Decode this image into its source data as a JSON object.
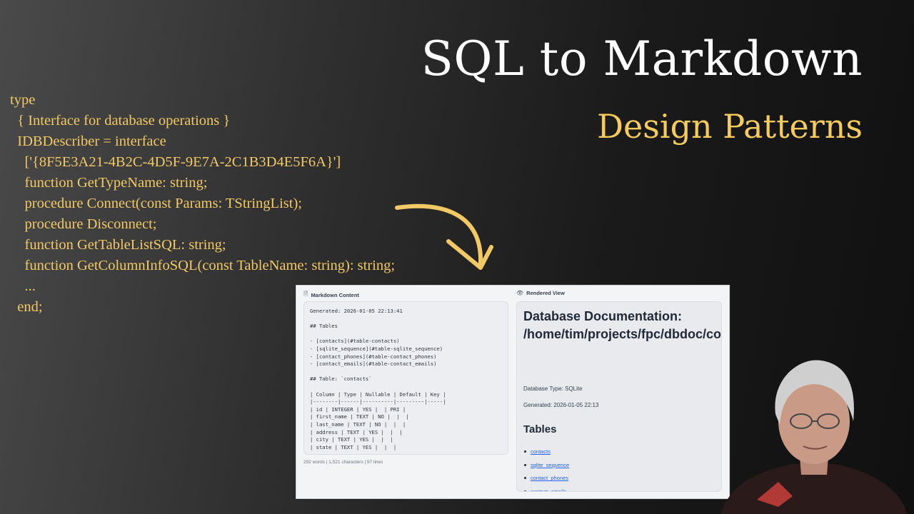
{
  "title": "SQL to Markdown",
  "subtitle": "Design Patterns",
  "colors": {
    "accent": "#f2c964",
    "link": "#2563eb"
  },
  "code_lines": [
    "type",
    "  { Interface for database operations }",
    "  IDBDescriber = interface",
    "    ['{8F5E3A21-4B2C-4D5F-9E7A-2C1B3D4E5F6A}']",
    "    function GetTypeName: string;",
    "    procedure Connect(const Params: TStringList);",
    "    procedure Disconnect;",
    "    function GetTableListSQL: string;",
    "    function GetColumnInfoSQL(const TableName: string): string;",
    "    ...",
    "  end;"
  ],
  "screenshot": {
    "markdown_panel": {
      "title": "Markdown Content",
      "icon": "file-icon",
      "lines": [
        "Generated: 2026-01-05 22:13:41",
        "",
        "## Tables",
        "",
        "- [contacts](#table-contacts)",
        "- [sqlite_sequence](#table-sqlite_sequence)",
        "- [contact_phones](#table-contact_phones)",
        "- [contact_emails](#table-contact_emails)",
        "",
        "## Table: `contacts`",
        "",
        "| Column | Type | Nullable | Default | Key |",
        "|--------|------|----------|---------|-----|",
        "| id | INTEGER | YES |  | PRI |",
        "| first_name | TEXT | NO |  |  |",
        "| last_name | TEXT | NO |  |  |",
        "| address | TEXT | YES |  |  |",
        "| city | TEXT | YES |  |  |",
        "| state | TEXT | YES |  |  |"
      ],
      "stats": "292 words | 1,521 characters | 57 lines"
    },
    "rendered_panel": {
      "title": "Rendered View",
      "icon": "eye-icon",
      "heading": "Database Documentation: /home/tim/projects/fpc/dbdoc/contacts.db",
      "db_type": "Database Type: SQLite",
      "generated": "Generated: 2026-01-05 22:13",
      "tables_heading": "Tables",
      "tables": [
        "contacts",
        "sqlite_sequence",
        "contact_phones",
        "contact_emails"
      ]
    }
  }
}
